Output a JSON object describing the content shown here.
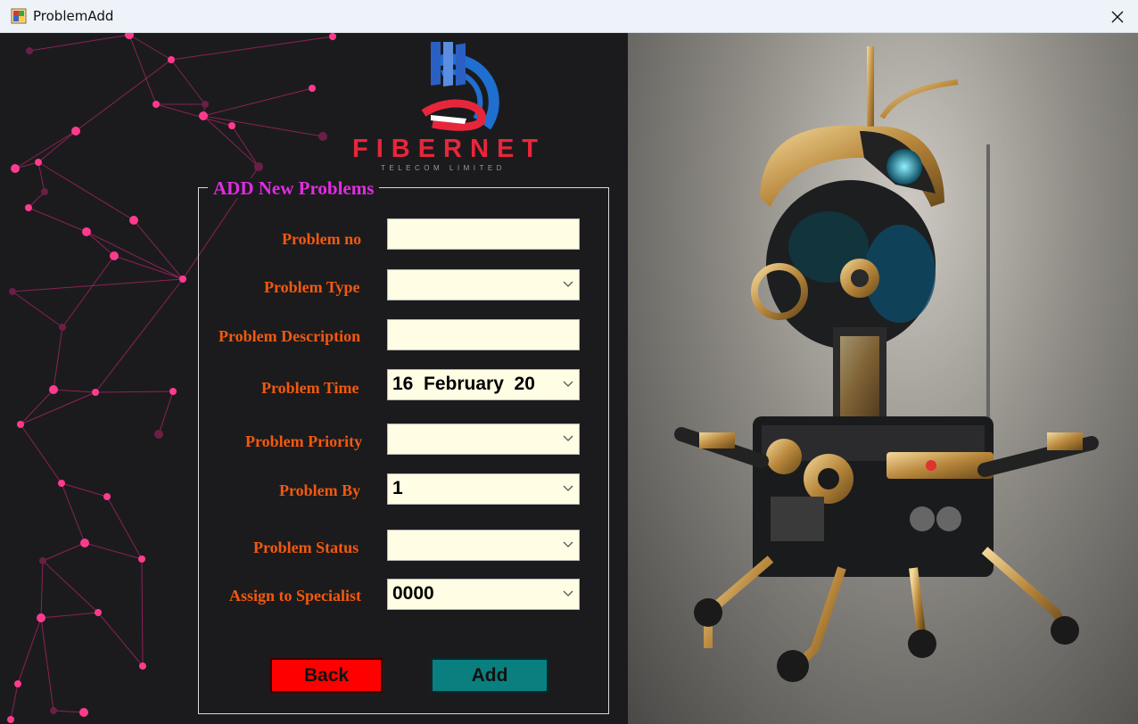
{
  "window": {
    "title": "ProblemAdd",
    "close_icon": "close-icon",
    "app_icon": "windows-form-icon"
  },
  "brand": {
    "name": "FIBERNET",
    "tagline": "TELECOM LIMITED",
    "accent_red": "#e8263b",
    "accent_blue": "#1f6fd1"
  },
  "form": {
    "group_title": "ADD New Problems",
    "fields": [
      {
        "label": "Problem no",
        "type": "text",
        "value": ""
      },
      {
        "label": "Problem Type",
        "type": "combo",
        "value": ""
      },
      {
        "label": "Problem Description",
        "type": "text",
        "value": ""
      },
      {
        "label": "Problem Time",
        "type": "date",
        "value": "16  February  20"
      },
      {
        "label": "Problem Priority",
        "type": "combo",
        "value": ""
      },
      {
        "label": "Problem By",
        "type": "combo",
        "value": "1"
      },
      {
        "label": "Problem Status",
        "type": "combo",
        "value": ""
      },
      {
        "label": "Assign to Specialist",
        "type": "combo",
        "value": "0000"
      }
    ],
    "back_label": "Back",
    "add_label": "Add"
  },
  "colors": {
    "label": "#f2590f",
    "group_title": "#e22be2",
    "input_bg": "#fffde3",
    "back_button": "#ff0000",
    "add_button": "#0a7f80",
    "network_node": "#ff3b8d"
  }
}
